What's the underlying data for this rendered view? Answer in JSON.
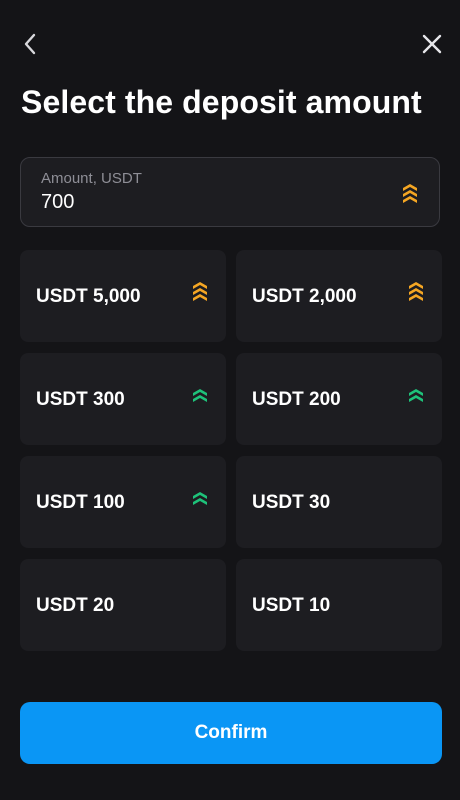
{
  "header": {
    "back_icon": "chevron-left-icon",
    "close_icon": "close-icon",
    "title": "Select the deposit amount"
  },
  "amount_field": {
    "label": "Amount, USDT",
    "value": "700",
    "icon": "triple-chevron-up-icon",
    "icon_color": "#f5a623"
  },
  "amount_options": [
    {
      "label": "USDT 5,000",
      "badge": "triple-chevron-up-icon",
      "badge_color": "#f5a623"
    },
    {
      "label": "USDT 2,000",
      "badge": "triple-chevron-up-icon",
      "badge_color": "#f5a623"
    },
    {
      "label": "USDT 300",
      "badge": "double-chevron-up-icon",
      "badge_color": "#1ec27a"
    },
    {
      "label": "USDT 200",
      "badge": "double-chevron-up-icon",
      "badge_color": "#1ec27a"
    },
    {
      "label": "USDT 100",
      "badge": "double-chevron-up-icon",
      "badge_color": "#1ec27a"
    },
    {
      "label": "USDT 30",
      "badge": null
    },
    {
      "label": "USDT 20",
      "badge": null
    },
    {
      "label": "USDT 10",
      "badge": null
    }
  ],
  "confirm_button": {
    "label": "Confirm",
    "color": "#0a96f5"
  },
  "colors": {
    "background": "#141417",
    "surface": "#1d1d21",
    "text": "#ffffff",
    "muted_text": "#8e8e96"
  }
}
